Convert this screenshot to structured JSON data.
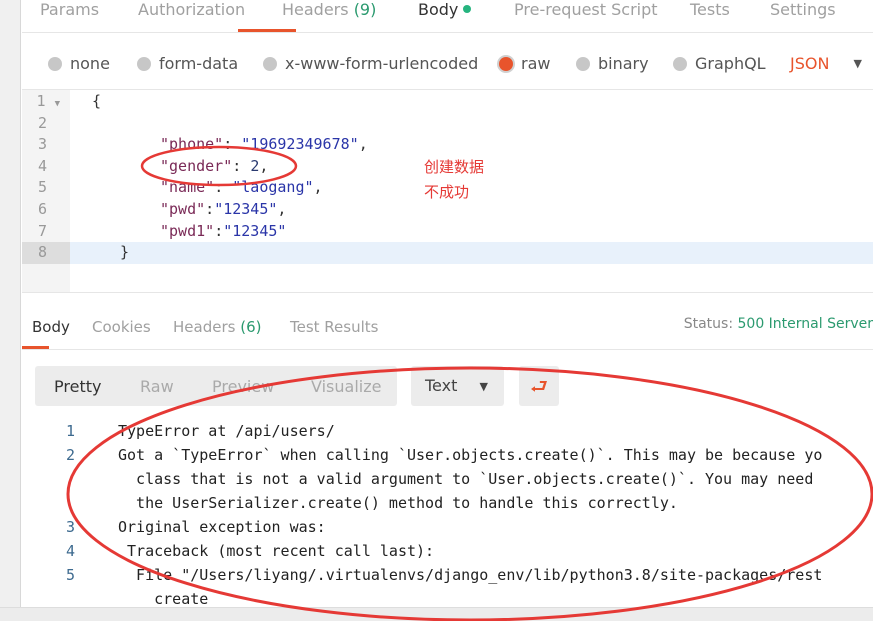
{
  "request_tabs": [
    {
      "label": "Params"
    },
    {
      "label": "Authorization"
    },
    {
      "label": "Headers",
      "count": "(9)"
    },
    {
      "label": "Body",
      "active": true
    },
    {
      "label": "Pre-request Script"
    },
    {
      "label": "Tests"
    },
    {
      "label": "Settings"
    }
  ],
  "body_types": [
    {
      "label": "none"
    },
    {
      "label": "form-data"
    },
    {
      "label": "x-www-form-urlencoded"
    },
    {
      "label": "raw",
      "selected": true
    },
    {
      "label": "binary"
    },
    {
      "label": "GraphQL"
    }
  ],
  "format_select": "JSON",
  "editor_lines": [
    "1",
    "2",
    "3",
    "4",
    "5",
    "6",
    "7",
    "8"
  ],
  "editor_code": {
    "open": "{",
    "phone_key": "\"phone\"",
    "phone_val": "\"19692349678\"",
    "gender_key": "\"gender\"",
    "gender_val": "2",
    "name_key": "\"name\"",
    "name_val": "\"laogang\"",
    "pwd_key": "\"pwd\"",
    "pwd_val": "\"12345\"",
    "pwd1_key": "\"pwd1\"",
    "pwd1_val": "\"12345\"",
    "close": "}"
  },
  "annotation": {
    "line1": "创建数据",
    "line2": "不成功",
    "color": "#e53935"
  },
  "response_tabs": [
    {
      "label": "Body",
      "active": true
    },
    {
      "label": "Cookies"
    },
    {
      "label": "Headers",
      "count": "(6)"
    },
    {
      "label": "Test Results"
    }
  ],
  "status": {
    "label": "Status:",
    "value": "500 Internal Server"
  },
  "view_modes": [
    "Pretty",
    "Raw",
    "Preview",
    "Visualize"
  ],
  "response_format": "Text",
  "response_lines": [
    {
      "n": "1",
      "text": "TypeError at /api/users/"
    },
    {
      "n": "2",
      "text": "Got a `TypeError` when calling `User.objects.create()`. This may be because yo"
    },
    {
      "n": "",
      "text": "  class that is not a valid argument to `User.objects.create()`. You may need"
    },
    {
      "n": "",
      "text": "  the UserSerializer.create() method to handle this correctly."
    },
    {
      "n": "3",
      "text": "Original exception was:"
    },
    {
      "n": "4",
      "text": " Traceback (most recent call last):"
    },
    {
      "n": "5",
      "text": "  File \"/Users/liyang/.virtualenvs/django_env/lib/python3.8/site-packages/rest"
    },
    {
      "n": "",
      "text": "    create"
    }
  ],
  "colors": {
    "accent": "#e8542c",
    "success": "#2b9a6f"
  }
}
